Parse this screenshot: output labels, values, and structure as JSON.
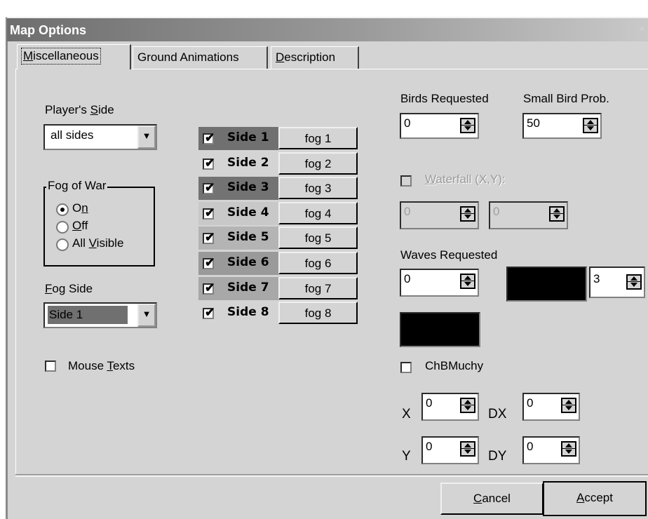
{
  "window": {
    "title": "Map Options",
    "close_glyph": "×"
  },
  "tabs": [
    {
      "label": "Miscellaneous",
      "mnemonic": "M",
      "rest": "iscellaneous",
      "active": true
    },
    {
      "label": "Ground Animations",
      "active": false
    },
    {
      "label": "Description",
      "mnemonic": "D",
      "rest": "escription",
      "active": false
    }
  ],
  "players_side": {
    "label_pre": "Player's ",
    "label_mn": "S",
    "label_post": "ide",
    "value": "all sides"
  },
  "fog_of_war": {
    "title": "Fog of War",
    "options": [
      {
        "pre": "O",
        "mn": "n",
        "post": "",
        "label": "On",
        "selected": true
      },
      {
        "pre": "",
        "mn": "O",
        "post": "ff",
        "label": "Off",
        "selected": false
      },
      {
        "pre": "All ",
        "mn": "V",
        "post": "isible",
        "label": "All Visible",
        "selected": false
      }
    ]
  },
  "fog_side": {
    "label_mn": "F",
    "label_post": "og Side",
    "value": "Side 1"
  },
  "mouse_texts": {
    "label_pre": "Mouse ",
    "label_mn": "T",
    "label_post": "exts",
    "checked": false
  },
  "sides": [
    {
      "name": "Side 1",
      "fog": "fog 1",
      "checked": true,
      "color": "#707070"
    },
    {
      "name": "Side 2",
      "fog": "fog 2",
      "checked": true,
      "color": "#d4d4d4"
    },
    {
      "name": "Side 3",
      "fog": "fog 3",
      "checked": true,
      "color": "#737373"
    },
    {
      "name": "Side 4",
      "fog": "fog 4",
      "checked": true,
      "color": "#c8c8c8"
    },
    {
      "name": "Side 5",
      "fog": "fog 5",
      "checked": true,
      "color": "#b4b4b4"
    },
    {
      "name": "Side 6",
      "fog": "fog 6",
      "checked": true,
      "color": "#9a9a9a"
    },
    {
      "name": "Side 7",
      "fog": "fog 7",
      "checked": true,
      "color": "#a8a8a8"
    },
    {
      "name": "Side 8",
      "fog": "fog 8",
      "checked": true,
      "color": "#d4d4d4"
    }
  ],
  "birds_requested": {
    "label": "Birds Requested",
    "value": "0"
  },
  "small_bird_prob": {
    "label": "Small Bird Prob.",
    "value": "50"
  },
  "waterfall": {
    "label_mn": "W",
    "label_post": "aterfall (X,Y):",
    "checked": false,
    "enabled": false,
    "x_value": "0",
    "y_value": "0"
  },
  "waves_requested": {
    "label": "Waves Requested",
    "value": "0",
    "count_value": "3"
  },
  "colors": {
    "swatch1": "#000000",
    "swatch2": "#000000",
    "window_bg": "#d4d4d4"
  },
  "chbmuchy": {
    "label": "ChBMuchy",
    "checked": false
  },
  "coords": {
    "x_label": "X",
    "x_value": "0",
    "dx_label": "DX",
    "dx_value": "0",
    "y_label": "Y",
    "y_value": "0",
    "dy_label": "DY",
    "dy_value": "0"
  },
  "buttons": {
    "cancel_mn": "C",
    "cancel_post": "ancel",
    "accept_mn": "A",
    "accept_post": "ccept"
  },
  "check_glyph": "✔"
}
